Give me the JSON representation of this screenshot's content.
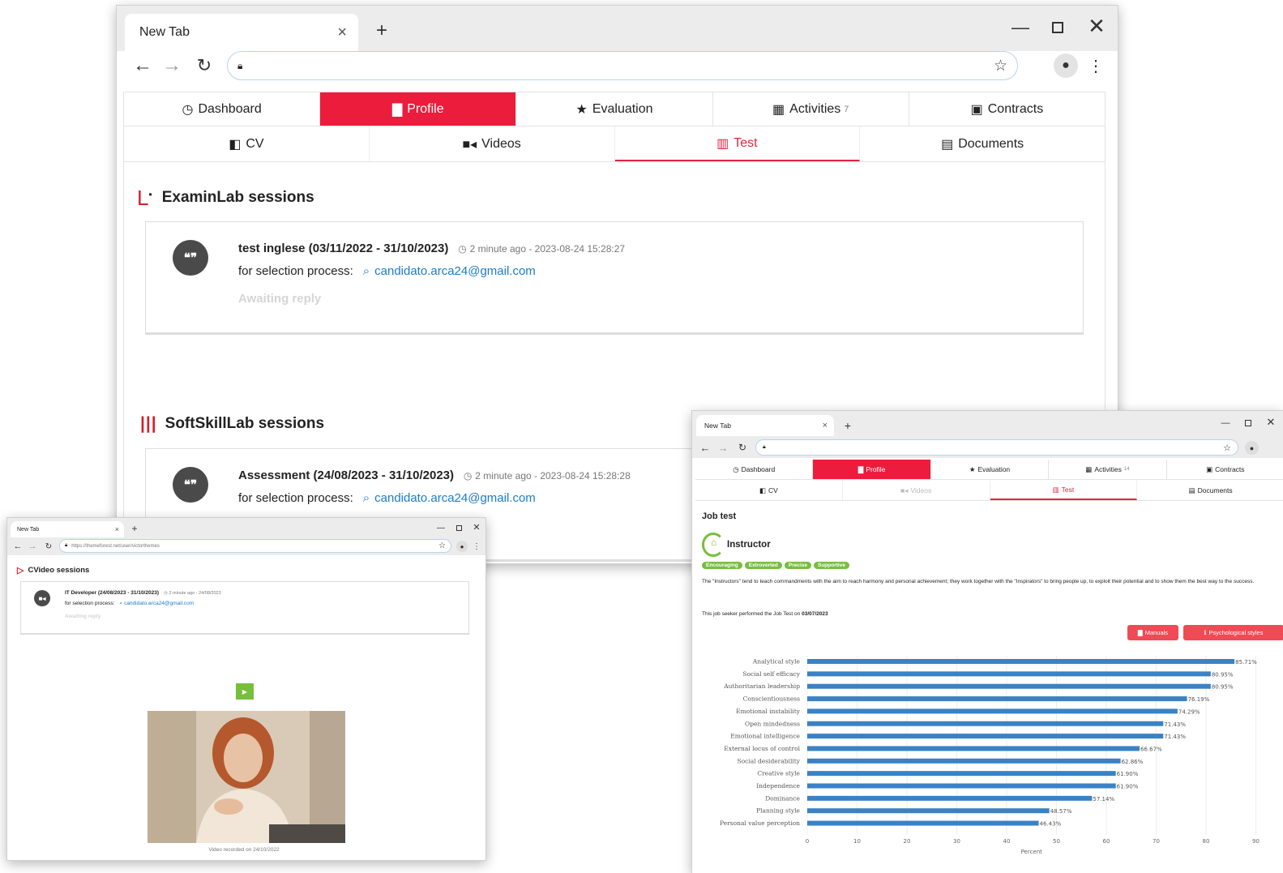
{
  "main_window": {
    "tab_title": "New Tab",
    "nav": [
      "Dashboard",
      "Profile",
      "Evaluation",
      "Activities",
      "Contracts"
    ],
    "activities_count": "7",
    "subnav": [
      "CV",
      "Videos",
      "Test",
      "Documents"
    ],
    "examinlab": {
      "heading": "ExaminLab sessions",
      "title": "test inglese (03/11/2022 - 31/10/2023)",
      "time": "2 minute ago - 2023-08-24 15:28:27",
      "selection_label": "for selection process:",
      "email": "candidato.arca24@gmail.com",
      "status": "Awaiting reply"
    },
    "softskill": {
      "heading": "SoftSkillLab sessions",
      "title": "Assessment (24/08/2023 - 31/10/2023)",
      "time": "2 minute ago - 2023-08-24 15:28:28",
      "selection_label": "for selection process:",
      "email": "candidato.arca24@gmail.com"
    }
  },
  "video_window": {
    "tab_title": "New Tab",
    "url": "https://themeforest.net/user/victorthemes",
    "heading": "CVideo sessions",
    "title": "IT Developer (24/08/2023 - 31/10/2023)",
    "time": "2 minute ago - 24/08/2023",
    "selection_label": "for selection process:",
    "email": "candidato.arca24@gmail.com",
    "status": "Awaiting reply",
    "caption": "Video recorded on 24/10/2022"
  },
  "test_window": {
    "tab_title": "New Tab",
    "nav": [
      "Dashboard",
      "Profile",
      "Evaluation",
      "Activities",
      "Contracts"
    ],
    "activities_count": "14",
    "subnav": [
      "CV",
      "Videos",
      "Test",
      "Documents"
    ],
    "heading": "Job test",
    "profile_name": "Instructor",
    "tags": [
      "Encouraging",
      "Extroverted",
      "Precise",
      "Supportive"
    ],
    "description": "The \"Instructors\" tend to teach commandments with the aim to reach harmony and personal achievement; they work together with the \"Inspirators\" to bring people up, to exploit their potential and to show them the best way to the success.",
    "performed_prefix": "This job seeker performed the Job Test on",
    "performed_date": "03/07/2023",
    "btn_manuals": "Manuals",
    "btn_styles": "Psychological styles"
  },
  "chart_data": {
    "type": "bar",
    "orientation": "horizontal",
    "categories": [
      "Analytical style",
      "Social self efficacy",
      "Authoritarian leadership",
      "Conscientiousness",
      "Emotional instability",
      "Open mindedness",
      "Emotional intelligence",
      "External locus of control",
      "Social desiderability",
      "Creative style",
      "Independence",
      "Dominance",
      "Planning style",
      "Personal value perception"
    ],
    "values": [
      85.71,
      80.95,
      80.95,
      76.19,
      74.29,
      71.43,
      71.43,
      66.67,
      62.86,
      61.9,
      61.9,
      57.14,
      48.57,
      46.43
    ],
    "value_labels": [
      "85.71%",
      "80.95%",
      "80.95%",
      "76.19%",
      "74.29%",
      "71.43%",
      "71.43%",
      "66.67%",
      "62.86%",
      "61.90%",
      "61.90%",
      "57.14%",
      "48.57%",
      "46.43%"
    ],
    "xticks": [
      "0",
      "10",
      "20",
      "30",
      "40",
      "50",
      "60",
      "70",
      "80",
      "90"
    ],
    "xlabel": "Percent",
    "xlim": [
      0,
      90
    ],
    "bar_color": "#3a82c4"
  }
}
